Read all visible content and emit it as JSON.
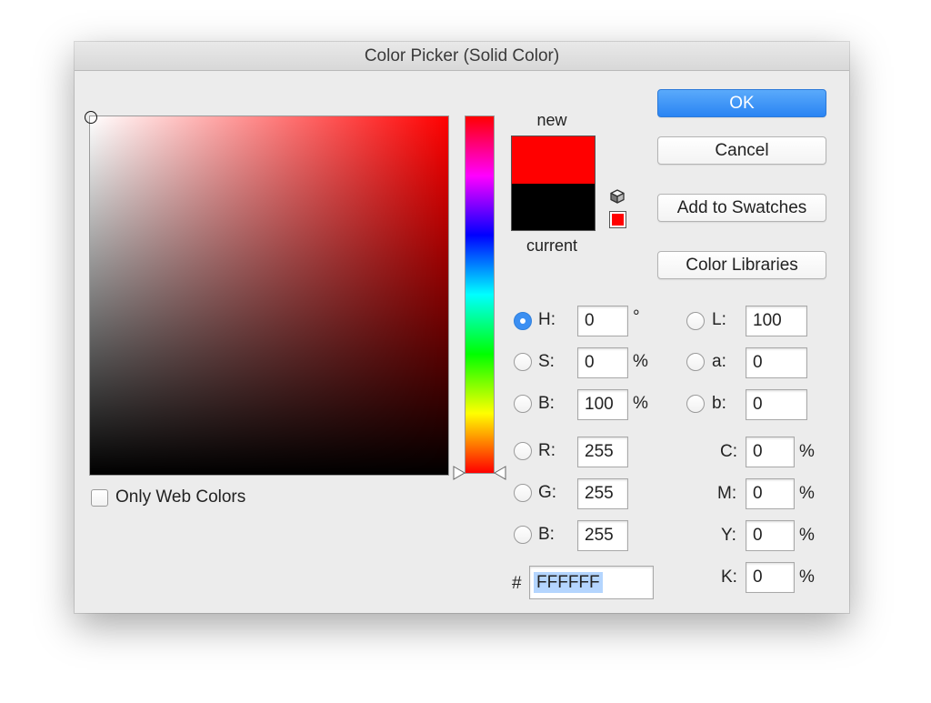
{
  "window": {
    "title": "Color Picker (Solid Color)"
  },
  "swatches": {
    "new_label": "new",
    "current_label": "current",
    "new_color": "#ff0000",
    "current_color": "#000000",
    "gamut_warning_color": "#ff0000"
  },
  "buttons": {
    "ok": "OK",
    "cancel": "Cancel",
    "add_to_swatches": "Add to Swatches",
    "color_libraries": "Color Libraries"
  },
  "web_colors": {
    "label": "Only Web Colors",
    "checked": false
  },
  "hsb": {
    "h": {
      "label": "H:",
      "value": "0",
      "unit": "°",
      "selected": true
    },
    "s": {
      "label": "S:",
      "value": "0",
      "unit": "%"
    },
    "b": {
      "label": "B:",
      "value": "100",
      "unit": "%"
    }
  },
  "rgb": {
    "r": {
      "label": "R:",
      "value": "255"
    },
    "g": {
      "label": "G:",
      "value": "255"
    },
    "b": {
      "label": "B:",
      "value": "255"
    }
  },
  "hex": {
    "label": "#",
    "value": "FFFFFF"
  },
  "lab": {
    "l": {
      "label": "L:",
      "value": "100"
    },
    "a": {
      "label": "a:",
      "value": "0"
    },
    "b": {
      "label": "b:",
      "value": "0"
    }
  },
  "cmyk": {
    "c": {
      "label": "C:",
      "value": "0",
      "unit": "%"
    },
    "m": {
      "label": "M:",
      "value": "0",
      "unit": "%"
    },
    "y": {
      "label": "Y:",
      "value": "0",
      "unit": "%"
    },
    "k": {
      "label": "K:",
      "value": "0",
      "unit": "%"
    }
  },
  "icons": {
    "picker_marker": "circle-marker-icon",
    "hue_slider": "triangle-arrow-icon",
    "gamut": "cube-icon"
  }
}
